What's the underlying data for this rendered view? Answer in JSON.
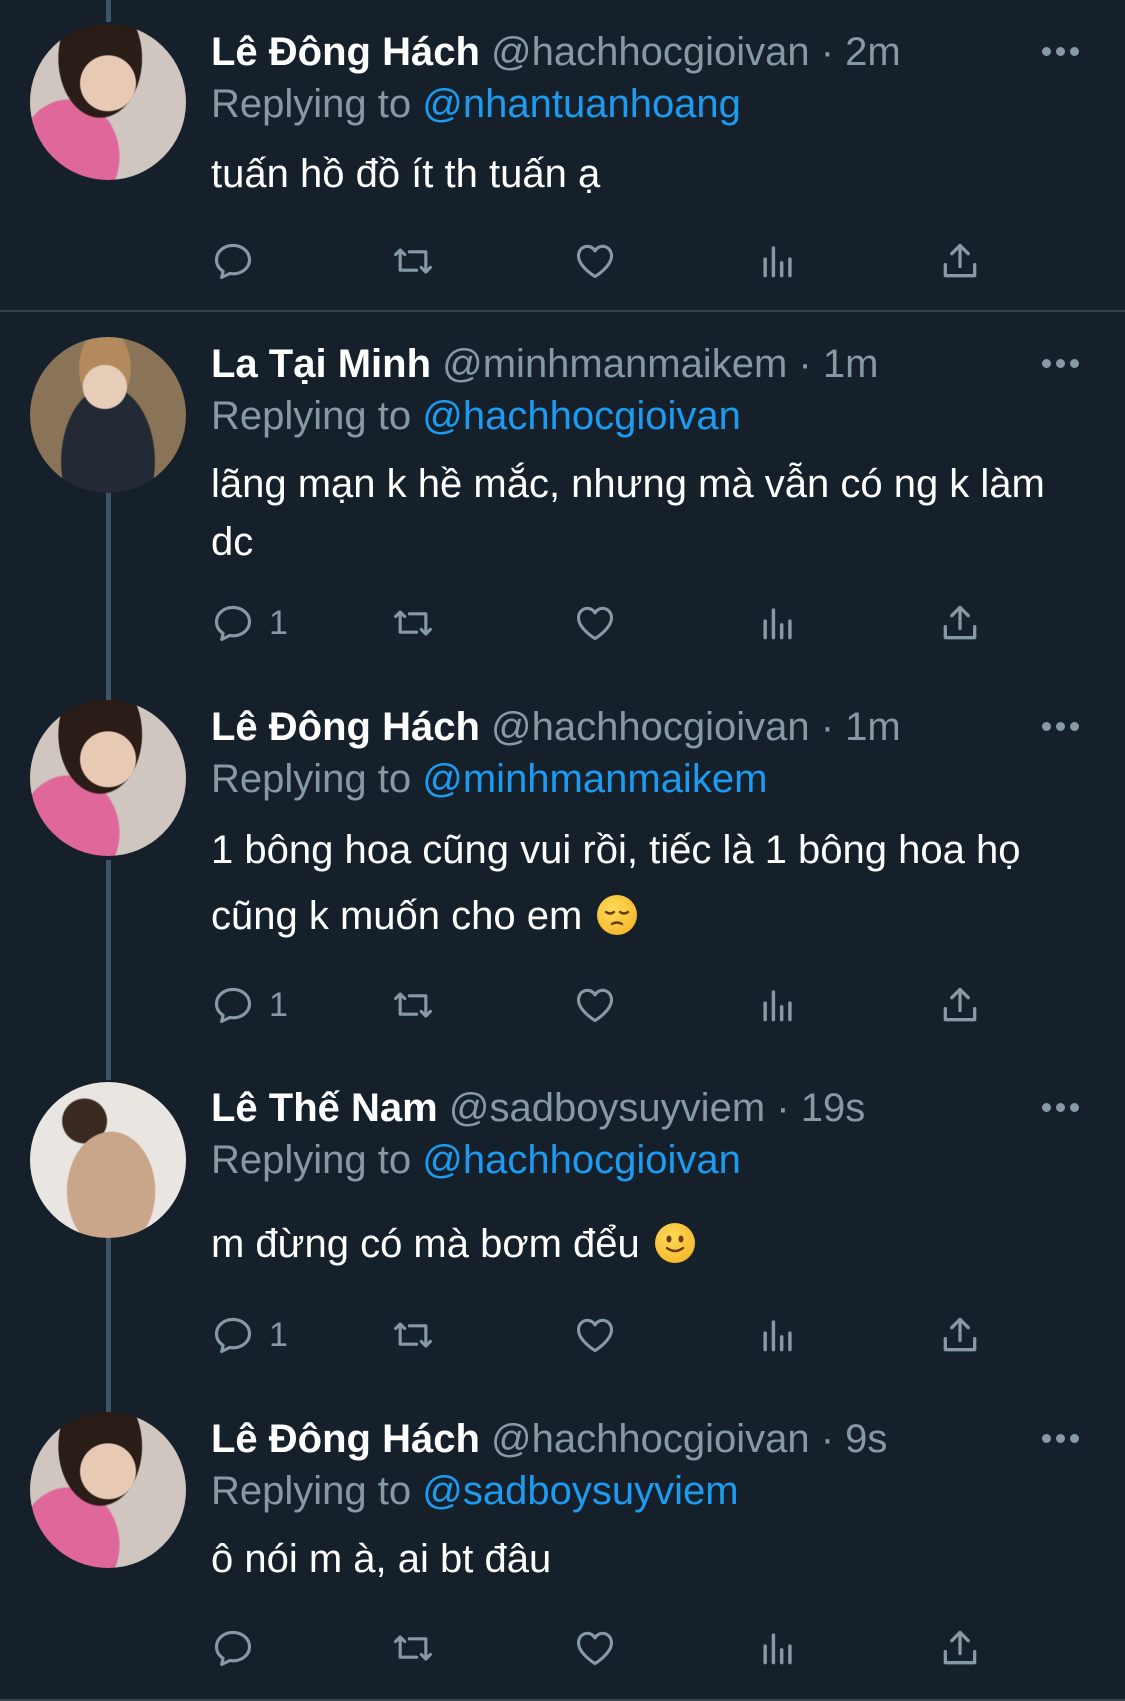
{
  "tweets": [
    {
      "name": "Lê Đông Hách",
      "handle": "@hachhocgioivan",
      "time": "· 2m",
      "replying_prefix": "Replying to",
      "replying_to": "@nhantuanhoang",
      "text": "tuấn hồ đồ ít th tuấn ạ",
      "reply_count": ""
    },
    {
      "name": "La Tại Minh",
      "handle": "@minhmanmaikem",
      "time": "· 1m",
      "replying_prefix": "Replying to",
      "replying_to": "@hachhocgioivan",
      "text": "lãng mạn k hề mắc, nhưng mà vẫn có ng k làm dc",
      "reply_count": "1"
    },
    {
      "name": "Lê Đông Hách",
      "handle": "@hachhocgioivan",
      "time": "· 1m",
      "replying_prefix": "Replying to",
      "replying_to": "@minhmanmaikem",
      "text": "1 bông hoa cũng vui rồi, tiếc là 1 bông hoa họ cũng k muốn cho em",
      "emoji": "pensive-face",
      "reply_count": "1"
    },
    {
      "name": "Lê Thế Nam",
      "handle": "@sadboysuyviem",
      "time": "· 19s",
      "replying_prefix": "Replying to",
      "replying_to": "@hachhocgioivan",
      "text": "m đừng có mà bơm đểu",
      "emoji": "slightly-smiling-face",
      "reply_count": "1"
    },
    {
      "name": "Lê Đông Hách",
      "handle": "@hachhocgioivan",
      "time": "· 9s",
      "replying_prefix": "Replying to",
      "replying_to": "@sadboysuyviem",
      "text": "ô nói m à, ai bt đâu",
      "reply_count": ""
    }
  ],
  "icons": [
    "reply-icon",
    "retweet-icon",
    "like-icon",
    "analytics-icon",
    "share-icon",
    "more-options-icon"
  ],
  "colors": {
    "background": "#15202b",
    "secondary_text": "#8899a6",
    "link": "#1d9bf0",
    "divider": "#38444d",
    "thread_line": "#3d5466"
  }
}
